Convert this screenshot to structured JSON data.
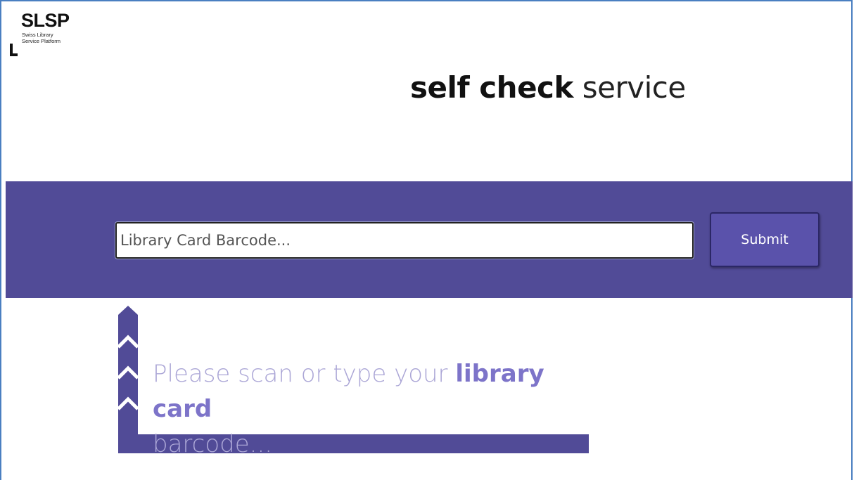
{
  "logo": {
    "name": "SLSP",
    "subtitle_line1": "Swiss Library",
    "subtitle_line2": "Service Platform"
  },
  "header": {
    "title_bold": "self check",
    "title_light": "service"
  },
  "form": {
    "barcode_placeholder": "Library Card Barcode...",
    "barcode_value": "",
    "submit_label": "Submit"
  },
  "prompt": {
    "text_before": "Please scan or type your ",
    "text_emphasis": "library card",
    "text_after": "barcode..."
  },
  "colors": {
    "band": "#514b97",
    "button": "#5a52ab",
    "prompt_light": "#aba6d6",
    "prompt_strong": "#7d74c9",
    "frame_border": "#4a7fc1"
  },
  "icons": {
    "guide_arrow": "up-arrow-chevrons-icon",
    "logo_corner": "corner-bracket-icon"
  }
}
